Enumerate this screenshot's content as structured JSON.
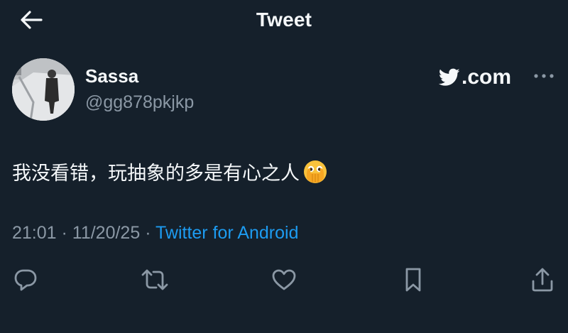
{
  "header": {
    "title": "Tweet",
    "back_icon": "arrow-left-icon"
  },
  "tweet": {
    "author": {
      "display_name": "Sassa",
      "handle": "@gg878pkjkp",
      "avatar_icon": "avatar-photo"
    },
    "brand": {
      "icon": "twitter-bird-icon",
      "text": ".com"
    },
    "more_icon": "more-dots-icon",
    "text": "我没看错，玩抽象的多是有心之人",
    "emoji": "face-with-open-eyes-and-hand-over-mouth-emoji",
    "time": "21:01",
    "separator_1": " · ",
    "date": "11/20/25",
    "separator_2": " · ",
    "source": "Twitter for Android"
  },
  "actions": {
    "reply_icon": "reply-icon",
    "retweet_icon": "retweet-icon",
    "like_icon": "heart-icon",
    "bookmark_icon": "bookmark-icon",
    "share_icon": "share-icon"
  },
  "colors": {
    "background": "#15202b",
    "text": "#f5f8fa",
    "muted": "#8b98a5",
    "link": "#1d9bf0"
  }
}
